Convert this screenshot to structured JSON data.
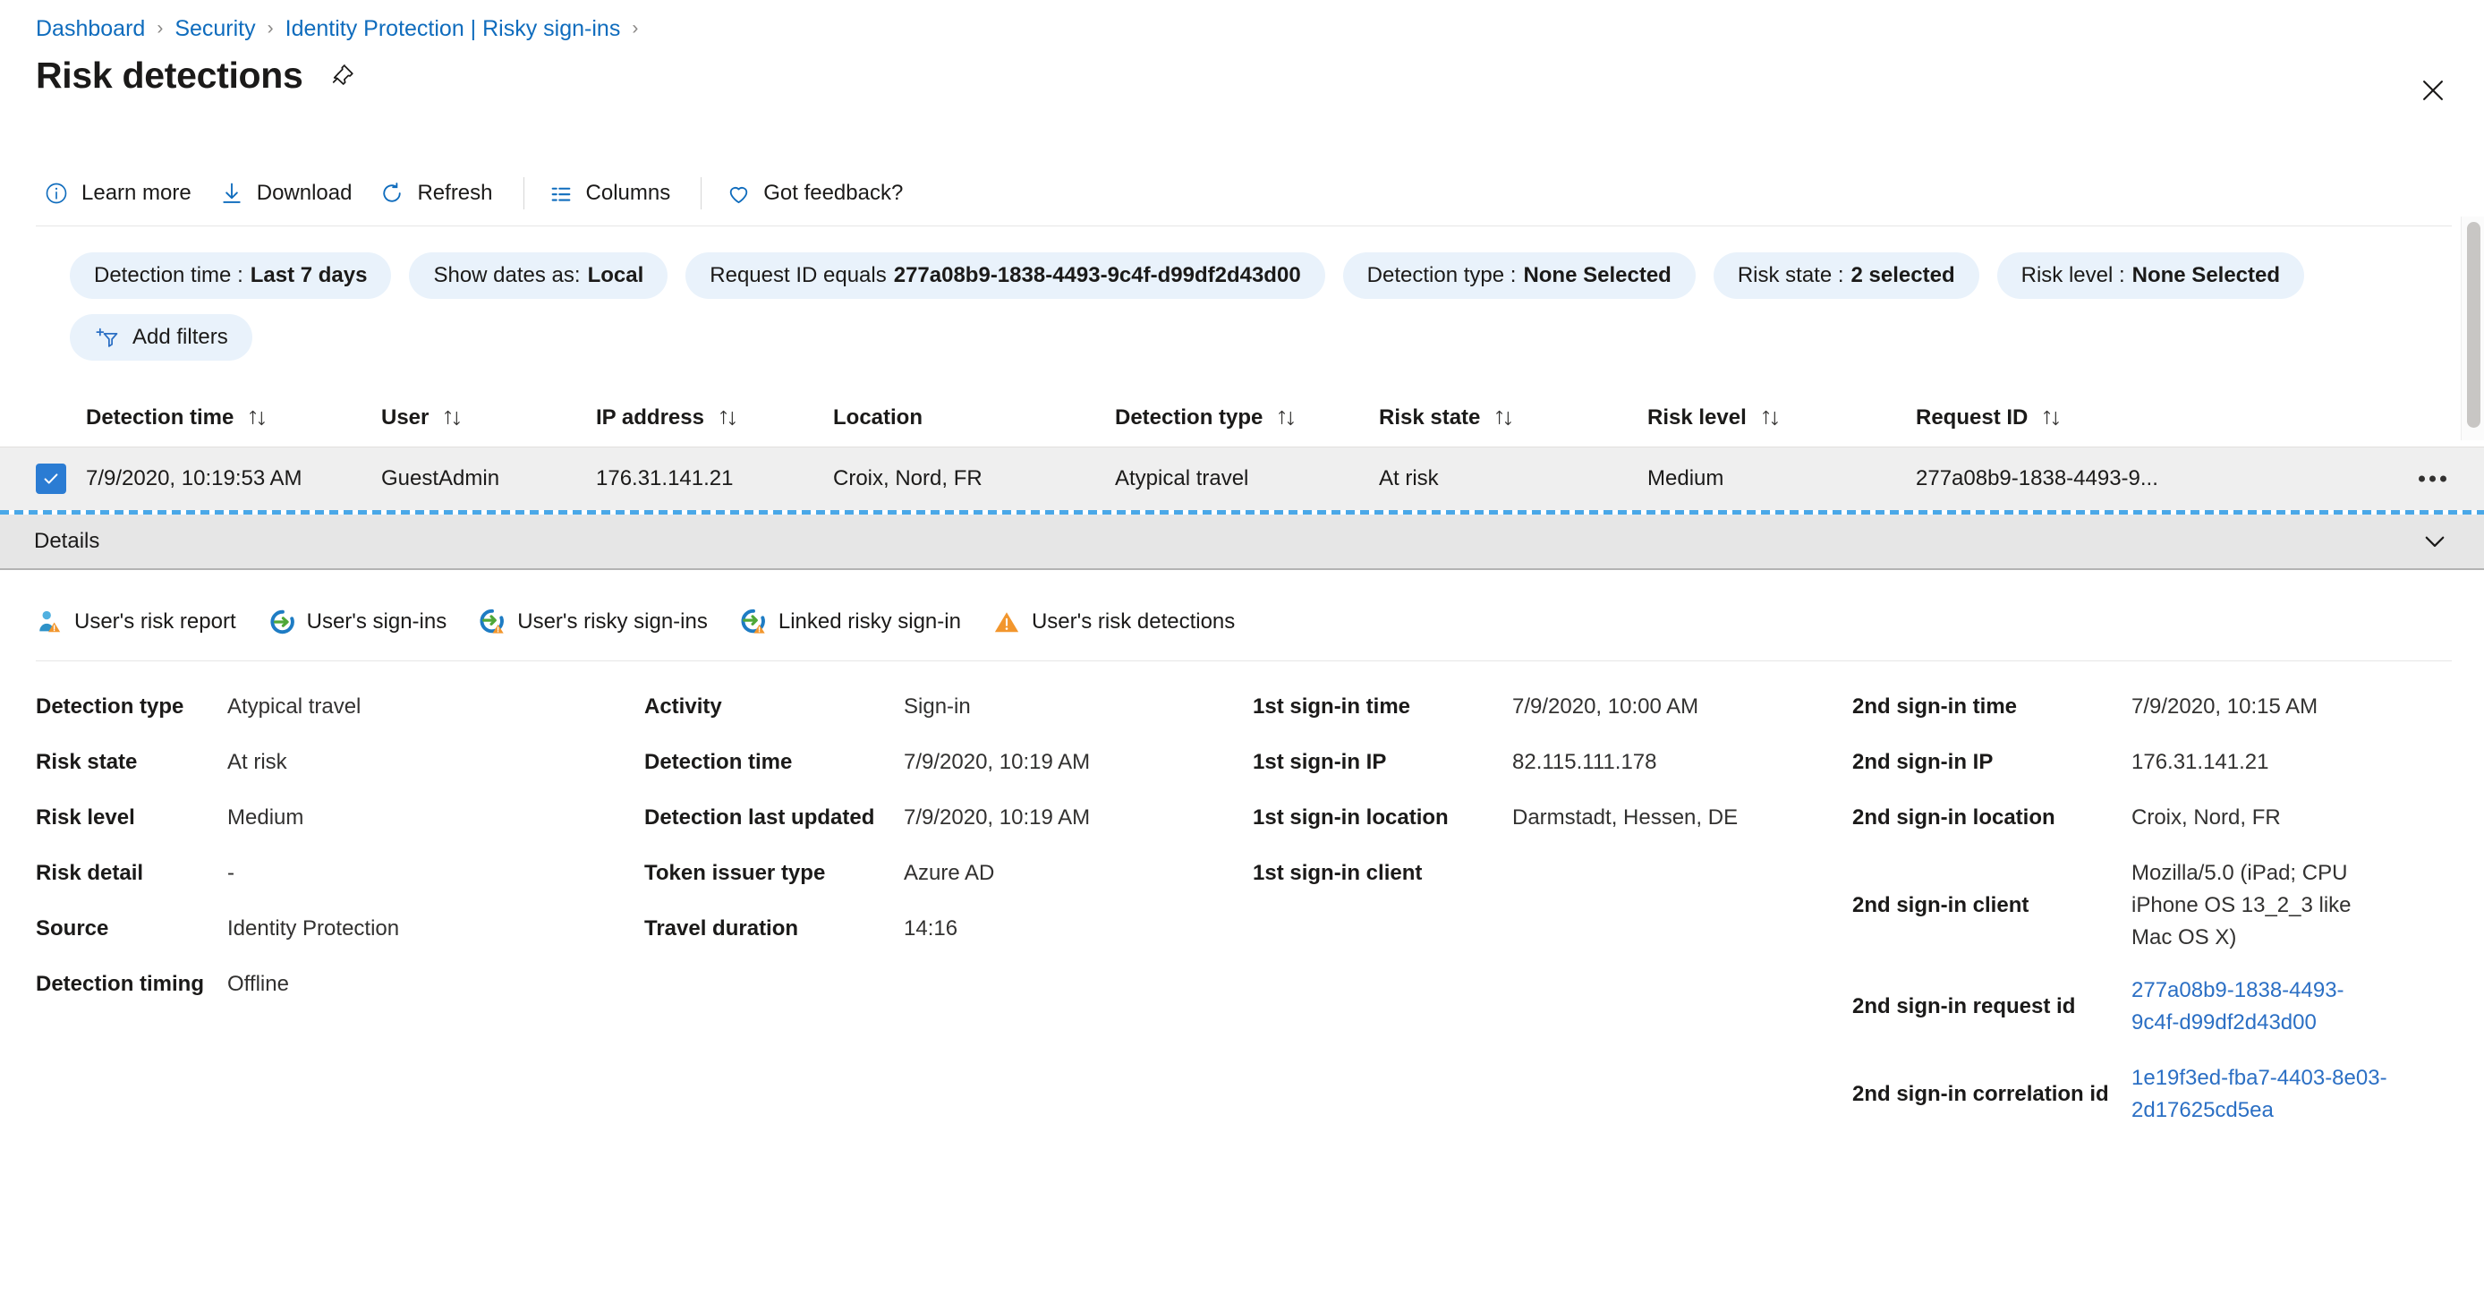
{
  "breadcrumb": {
    "items": [
      {
        "label": "Dashboard"
      },
      {
        "label": "Security"
      },
      {
        "label": "Identity Protection | Risky sign-ins"
      }
    ],
    "separator": "›"
  },
  "header": {
    "title": "Risk detections",
    "pin_icon": "pin-icon",
    "close_icon": "close-icon"
  },
  "toolbar": {
    "items": [
      {
        "label": "Learn more",
        "icon": "info-icon"
      },
      {
        "label": "Download",
        "icon": "download-icon"
      },
      {
        "label": "Refresh",
        "icon": "refresh-icon"
      },
      {
        "label": "Columns",
        "icon": "columns-icon"
      },
      {
        "label": "Got feedback?",
        "icon": "heart-icon"
      }
    ]
  },
  "filters": {
    "pills": [
      {
        "label": "Detection time :",
        "value": "Last 7 days"
      },
      {
        "label": "Show dates as:",
        "value": "Local"
      },
      {
        "label": "Request ID equals",
        "value": "277a08b9-1838-4493-9c4f-d99df2d43d00"
      },
      {
        "label": "Detection type :",
        "value": "None Selected"
      },
      {
        "label": "Risk state :",
        "value": "2 selected"
      },
      {
        "label": "Risk level :",
        "value": "None Selected"
      }
    ],
    "add_filters_label": "Add filters",
    "add_filters_icon": "add-filter-icon"
  },
  "table": {
    "columns": [
      {
        "label": "Detection time"
      },
      {
        "label": "User"
      },
      {
        "label": "IP address"
      },
      {
        "label": "Location"
      },
      {
        "label": "Detection type"
      },
      {
        "label": "Risk state"
      },
      {
        "label": "Risk level"
      },
      {
        "label": "Request ID"
      }
    ],
    "sort_icon": "sort-ascending-descending-icon",
    "rows": [
      {
        "selected": true,
        "detection_time": "7/9/2020, 10:19:53 AM",
        "user": "GuestAdmin",
        "ip_address": "176.31.141.21",
        "location": "Croix, Nord, FR",
        "detection_type": "Atypical travel",
        "risk_state": "At risk",
        "risk_level": "Medium",
        "request_id": "277a08b9-1838-4493-9..."
      }
    ]
  },
  "details_panel": {
    "title": "Details",
    "collapse_icon": "chevron-down-icon",
    "actions": [
      {
        "label": "User's risk report",
        "icon": "user-risk-report-icon"
      },
      {
        "label": "User's sign-ins",
        "icon": "user-signins-icon"
      },
      {
        "label": "User's risky sign-ins",
        "icon": "user-risky-signins-icon"
      },
      {
        "label": "Linked risky sign-in",
        "icon": "linked-risky-signin-icon"
      },
      {
        "label": "User's risk detections",
        "icon": "warning-triangle-icon"
      }
    ],
    "column1": [
      {
        "key": "Detection type",
        "value": "Atypical travel"
      },
      {
        "key": "Risk state",
        "value": "At risk"
      },
      {
        "key": "Risk level",
        "value": "Medium"
      },
      {
        "key": "Risk detail",
        "value": "-"
      },
      {
        "key": "Source",
        "value": "Identity Protection"
      },
      {
        "key": "Detection timing",
        "value": "Offline"
      }
    ],
    "column2": [
      {
        "key": "Activity",
        "value": "Sign-in"
      },
      {
        "key": "Detection time",
        "value": "7/9/2020, 10:19 AM"
      },
      {
        "key": "Detection last updated",
        "value": "7/9/2020, 10:19 AM"
      },
      {
        "key": "Token issuer type",
        "value": "Azure AD"
      },
      {
        "key": "Travel duration",
        "value": "14:16"
      }
    ],
    "column3": [
      {
        "key": "1st sign-in time",
        "value": "7/9/2020, 10:00 AM"
      },
      {
        "key": "1st sign-in IP",
        "value": "82.115.111.178"
      },
      {
        "key": "1st sign-in location",
        "value": "Darmstadt, Hessen, DE"
      },
      {
        "key": "1st sign-in client",
        "value": ""
      }
    ],
    "column4": [
      {
        "key": "2nd sign-in time",
        "value": "7/9/2020, 10:15 AM"
      },
      {
        "key": "2nd sign-in IP",
        "value": "176.31.141.21"
      },
      {
        "key": "2nd sign-in location",
        "value": "Croix, Nord, FR"
      },
      {
        "key": "2nd sign-in client",
        "value": "Mozilla/5.0 (iPad; CPU iPhone OS 13_2_3 like Mac OS X)"
      },
      {
        "key": "2nd sign-in request id",
        "value": "277a08b9-1838-4493-9c4f-d99df2d43d00",
        "link": true
      },
      {
        "key": "2nd sign-in correlation id",
        "value": "1e19f3ed-fba7-4403-8e03-2d17625cd5ea",
        "link": true
      }
    ]
  },
  "colors": {
    "link": "#0f6cbd",
    "accent": "#2b7cd3",
    "pill_bg": "#e9f2fb",
    "row_selected_bg": "#efefef",
    "details_bar_bg": "#e6e6e6",
    "warning_orange": "#f2962d"
  }
}
